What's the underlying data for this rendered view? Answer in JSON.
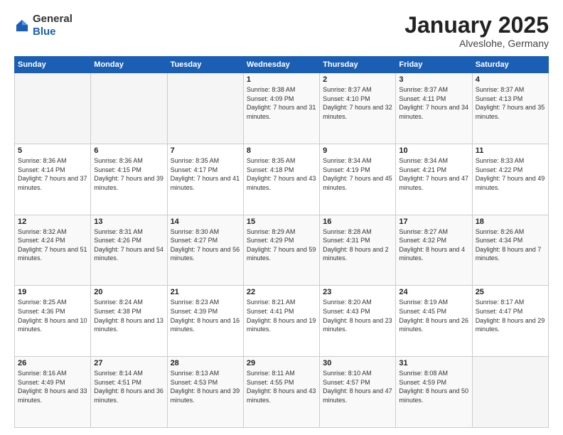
{
  "header": {
    "logo_general": "General",
    "logo_blue": "Blue",
    "month": "January 2025",
    "location": "Alveslohe, Germany"
  },
  "weekdays": [
    "Sunday",
    "Monday",
    "Tuesday",
    "Wednesday",
    "Thursday",
    "Friday",
    "Saturday"
  ],
  "weeks": [
    [
      {
        "day": "",
        "sunrise": "",
        "sunset": "",
        "daylight": ""
      },
      {
        "day": "",
        "sunrise": "",
        "sunset": "",
        "daylight": ""
      },
      {
        "day": "",
        "sunrise": "",
        "sunset": "",
        "daylight": ""
      },
      {
        "day": "1",
        "sunrise": "Sunrise: 8:38 AM",
        "sunset": "Sunset: 4:09 PM",
        "daylight": "Daylight: 7 hours and 31 minutes."
      },
      {
        "day": "2",
        "sunrise": "Sunrise: 8:37 AM",
        "sunset": "Sunset: 4:10 PM",
        "daylight": "Daylight: 7 hours and 32 minutes."
      },
      {
        "day": "3",
        "sunrise": "Sunrise: 8:37 AM",
        "sunset": "Sunset: 4:11 PM",
        "daylight": "Daylight: 7 hours and 34 minutes."
      },
      {
        "day": "4",
        "sunrise": "Sunrise: 8:37 AM",
        "sunset": "Sunset: 4:13 PM",
        "daylight": "Daylight: 7 hours and 35 minutes."
      }
    ],
    [
      {
        "day": "5",
        "sunrise": "Sunrise: 8:36 AM",
        "sunset": "Sunset: 4:14 PM",
        "daylight": "Daylight: 7 hours and 37 minutes."
      },
      {
        "day": "6",
        "sunrise": "Sunrise: 8:36 AM",
        "sunset": "Sunset: 4:15 PM",
        "daylight": "Daylight: 7 hours and 39 minutes."
      },
      {
        "day": "7",
        "sunrise": "Sunrise: 8:35 AM",
        "sunset": "Sunset: 4:17 PM",
        "daylight": "Daylight: 7 hours and 41 minutes."
      },
      {
        "day": "8",
        "sunrise": "Sunrise: 8:35 AM",
        "sunset": "Sunset: 4:18 PM",
        "daylight": "Daylight: 7 hours and 43 minutes."
      },
      {
        "day": "9",
        "sunrise": "Sunrise: 8:34 AM",
        "sunset": "Sunset: 4:19 PM",
        "daylight": "Daylight: 7 hours and 45 minutes."
      },
      {
        "day": "10",
        "sunrise": "Sunrise: 8:34 AM",
        "sunset": "Sunset: 4:21 PM",
        "daylight": "Daylight: 7 hours and 47 minutes."
      },
      {
        "day": "11",
        "sunrise": "Sunrise: 8:33 AM",
        "sunset": "Sunset: 4:22 PM",
        "daylight": "Daylight: 7 hours and 49 minutes."
      }
    ],
    [
      {
        "day": "12",
        "sunrise": "Sunrise: 8:32 AM",
        "sunset": "Sunset: 4:24 PM",
        "daylight": "Daylight: 7 hours and 51 minutes."
      },
      {
        "day": "13",
        "sunrise": "Sunrise: 8:31 AM",
        "sunset": "Sunset: 4:26 PM",
        "daylight": "Daylight: 7 hours and 54 minutes."
      },
      {
        "day": "14",
        "sunrise": "Sunrise: 8:30 AM",
        "sunset": "Sunset: 4:27 PM",
        "daylight": "Daylight: 7 hours and 56 minutes."
      },
      {
        "day": "15",
        "sunrise": "Sunrise: 8:29 AM",
        "sunset": "Sunset: 4:29 PM",
        "daylight": "Daylight: 7 hours and 59 minutes."
      },
      {
        "day": "16",
        "sunrise": "Sunrise: 8:28 AM",
        "sunset": "Sunset: 4:31 PM",
        "daylight": "Daylight: 8 hours and 2 minutes."
      },
      {
        "day": "17",
        "sunrise": "Sunrise: 8:27 AM",
        "sunset": "Sunset: 4:32 PM",
        "daylight": "Daylight: 8 hours and 4 minutes."
      },
      {
        "day": "18",
        "sunrise": "Sunrise: 8:26 AM",
        "sunset": "Sunset: 4:34 PM",
        "daylight": "Daylight: 8 hours and 7 minutes."
      }
    ],
    [
      {
        "day": "19",
        "sunrise": "Sunrise: 8:25 AM",
        "sunset": "Sunset: 4:36 PM",
        "daylight": "Daylight: 8 hours and 10 minutes."
      },
      {
        "day": "20",
        "sunrise": "Sunrise: 8:24 AM",
        "sunset": "Sunset: 4:38 PM",
        "daylight": "Daylight: 8 hours and 13 minutes."
      },
      {
        "day": "21",
        "sunrise": "Sunrise: 8:23 AM",
        "sunset": "Sunset: 4:39 PM",
        "daylight": "Daylight: 8 hours and 16 minutes."
      },
      {
        "day": "22",
        "sunrise": "Sunrise: 8:21 AM",
        "sunset": "Sunset: 4:41 PM",
        "daylight": "Daylight: 8 hours and 19 minutes."
      },
      {
        "day": "23",
        "sunrise": "Sunrise: 8:20 AM",
        "sunset": "Sunset: 4:43 PM",
        "daylight": "Daylight: 8 hours and 23 minutes."
      },
      {
        "day": "24",
        "sunrise": "Sunrise: 8:19 AM",
        "sunset": "Sunset: 4:45 PM",
        "daylight": "Daylight: 8 hours and 26 minutes."
      },
      {
        "day": "25",
        "sunrise": "Sunrise: 8:17 AM",
        "sunset": "Sunset: 4:47 PM",
        "daylight": "Daylight: 8 hours and 29 minutes."
      }
    ],
    [
      {
        "day": "26",
        "sunrise": "Sunrise: 8:16 AM",
        "sunset": "Sunset: 4:49 PM",
        "daylight": "Daylight: 8 hours and 33 minutes."
      },
      {
        "day": "27",
        "sunrise": "Sunrise: 8:14 AM",
        "sunset": "Sunset: 4:51 PM",
        "daylight": "Daylight: 8 hours and 36 minutes."
      },
      {
        "day": "28",
        "sunrise": "Sunrise: 8:13 AM",
        "sunset": "Sunset: 4:53 PM",
        "daylight": "Daylight: 8 hours and 39 minutes."
      },
      {
        "day": "29",
        "sunrise": "Sunrise: 8:11 AM",
        "sunset": "Sunset: 4:55 PM",
        "daylight": "Daylight: 8 hours and 43 minutes."
      },
      {
        "day": "30",
        "sunrise": "Sunrise: 8:10 AM",
        "sunset": "Sunset: 4:57 PM",
        "daylight": "Daylight: 8 hours and 47 minutes."
      },
      {
        "day": "31",
        "sunrise": "Sunrise: 8:08 AM",
        "sunset": "Sunset: 4:59 PM",
        "daylight": "Daylight: 8 hours and 50 minutes."
      },
      {
        "day": "",
        "sunrise": "",
        "sunset": "",
        "daylight": ""
      }
    ]
  ]
}
